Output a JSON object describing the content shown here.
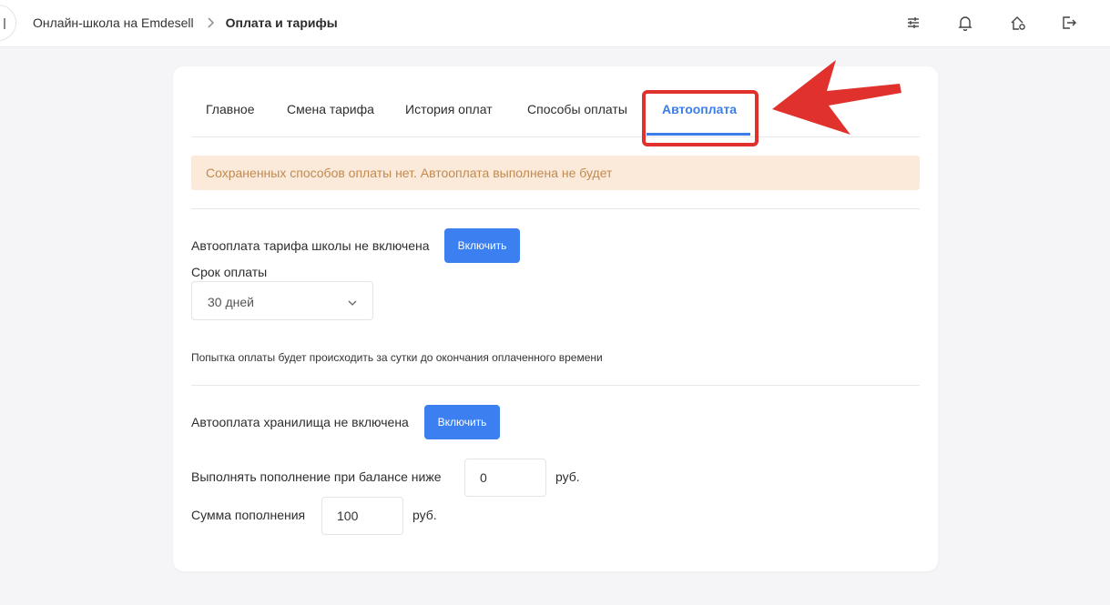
{
  "header": {
    "breadcrumb_root": "Онлайн-школа на Emdesell",
    "breadcrumb_current": "Оплата и тарифы",
    "icons": [
      "menu-icon",
      "sliders-icon",
      "bell-icon",
      "home-settings-icon",
      "logout-icon"
    ]
  },
  "tabs": [
    {
      "label": "Главное"
    },
    {
      "label": "Смена тарифа"
    },
    {
      "label": "История оплат"
    },
    {
      "label": "Способы оплаты"
    },
    {
      "label": "Автооплата",
      "active": true
    }
  ],
  "alert": {
    "text": "Сохраненных способов оплаты нет. Автооплата выполнена не будет"
  },
  "tariff": {
    "status_text": "Автооплата тарифа школы не включена",
    "enable_label": "Включить",
    "period_label": "Срок оплаты",
    "period_value": "30 дней",
    "note": "Попытка оплаты будет происходить за сутки до окончания оплаченного времени"
  },
  "storage": {
    "status_text": "Автооплата хранилища не включена",
    "enable_label": "Включить",
    "threshold_label": "Выполнять пополнение при балансе ниже",
    "threshold_value": "0",
    "threshold_unit": "руб.",
    "amount_label": "Сумма пополнения",
    "amount_value": "100",
    "amount_unit": "руб."
  },
  "colors": {
    "accent": "#3b7de9",
    "button": "#3b7ff0",
    "alert_bg": "#fbead9",
    "alert_text": "#c08a52",
    "annotation": "#e0312d"
  }
}
